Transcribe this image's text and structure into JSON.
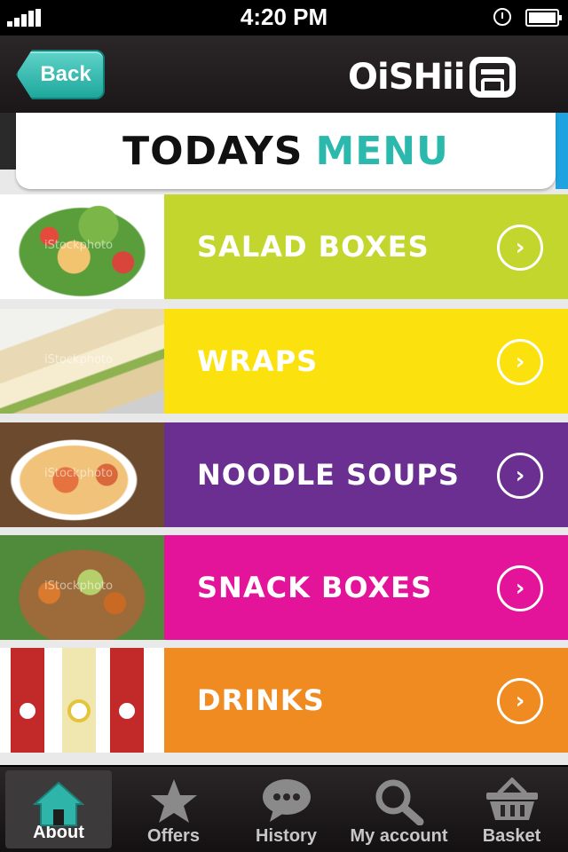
{
  "status_bar": {
    "time": "4:20 PM"
  },
  "header": {
    "back_label": "Back",
    "logo_text": "OiSHii"
  },
  "title": {
    "part1": "TODAYS",
    "part2": "MENU"
  },
  "menu": [
    {
      "label": "SALAD BOXES",
      "color": "#c2d62e"
    },
    {
      "label": "WRAPS",
      "color": "#fbe20f"
    },
    {
      "label": "NOODLE SOUPS",
      "color": "#6a2f90"
    },
    {
      "label": "SNACK BOXES",
      "color": "#e3149a"
    },
    {
      "label": "DRINKS",
      "color": "#f08b22"
    }
  ],
  "thumb_watermark": "iStockphoto",
  "tab_bar": {
    "tabs": [
      {
        "label": "About",
        "icon": "home-icon",
        "active": true
      },
      {
        "label": "Offers",
        "icon": "star-icon",
        "active": false
      },
      {
        "label": "History",
        "icon": "chat-bubble-icon",
        "active": false
      },
      {
        "label": "My account",
        "icon": "search-icon",
        "active": false
      },
      {
        "label": "Basket",
        "icon": "basket-icon",
        "active": false
      }
    ]
  },
  "colors": {
    "accent": "#2bb8ad",
    "header": "#1f1b1c"
  }
}
